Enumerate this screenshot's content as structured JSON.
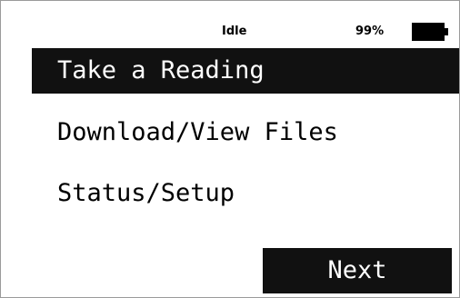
{
  "status_bar": {
    "state": "Idle",
    "battery_percent": "99%",
    "battery_icon": "battery-full-icon",
    "battery_level": 0.99
  },
  "menu": {
    "items": [
      {
        "label": "Take a Reading",
        "selected": true
      },
      {
        "label": "Download/View Files",
        "selected": false
      },
      {
        "label": "Status/Setup",
        "selected": false
      }
    ]
  },
  "softkeys": {
    "next_label": "Next"
  },
  "colors": {
    "background": "#ffffff",
    "highlight": "#111111",
    "highlight_text": "#ffffff",
    "text": "#000000"
  }
}
